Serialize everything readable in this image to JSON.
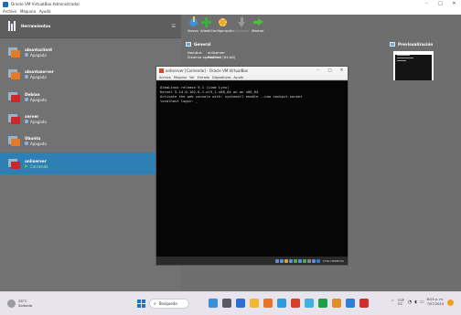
{
  "window": {
    "title": "Oracle VM VirtualBox Administrador",
    "controls": [
      "–",
      "□",
      "✕"
    ]
  },
  "menubar": [
    "Archivo",
    "Máquina",
    "Ayuda"
  ],
  "vm_list": {
    "tools_label": "Herramientas",
    "items": [
      {
        "name": "ubuntuclient",
        "state": "Apagada",
        "color": "#e07b2a",
        "selected": false
      },
      {
        "name": "ubuntuserver",
        "state": "Apagada",
        "color": "#e07b2a",
        "selected": false
      },
      {
        "name": "Debian",
        "state": "Apagada",
        "color": "#c9272a",
        "selected": false
      },
      {
        "name": "xerver",
        "state": "Apagada",
        "color": "#c9272a",
        "selected": false
      },
      {
        "name": "Ubuntu",
        "state": "Apagada",
        "color": "#e07b2a",
        "selected": false
      },
      {
        "name": "onliserver",
        "state": "Corriendo",
        "color": "#c9272a",
        "selected": true
      }
    ]
  },
  "toolbar": {
    "buttons": [
      {
        "label": "Nueva",
        "enabled": true
      },
      {
        "label": "Añadir",
        "enabled": true
      },
      {
        "label": "Configuración",
        "enabled": true
      },
      {
        "label": "Descartar",
        "enabled": false
      },
      {
        "label": "Mostrar",
        "enabled": true
      }
    ]
  },
  "details": {
    "general_title": "General",
    "name_key": "Nombre:",
    "name_value": "onliserver",
    "os_key": "Sistema operativo:",
    "os_value": "Red Hat (64-bit)",
    "preview_title": "Previsualización"
  },
  "vm_window": {
    "title": "onliserver [Corriendo] - Oracle VM VirtualBox",
    "menu": [
      "Archivo",
      "Máquina",
      "Ver",
      "Entrada",
      "Dispositivos",
      "Ayuda"
    ],
    "console_lines": [
      "AlmaLinux release 9.1 (Lime Lynx)",
      "Kernel 5.14.0-162.6.1.el9_1.x86_64 on an x86_64",
      "",
      "Activate the web console with: systemctl enable --now cockpit.socket",
      "",
      "localhost login: _"
    ],
    "host_key": "CTRL DERECHA"
  },
  "taskbar": {
    "weather_temp": "28°C",
    "weather_desc": "Soleado",
    "search_label": "Búsqueda",
    "lang_top": "ESP",
    "lang_bottom": "ES",
    "time": "8:03 p. m.",
    "date": "7/07/2024"
  },
  "colors": {
    "selection": "#2d7fb4",
    "vm_list_bg": "#727272",
    "taskbar_bg": "#e8e4ee"
  }
}
